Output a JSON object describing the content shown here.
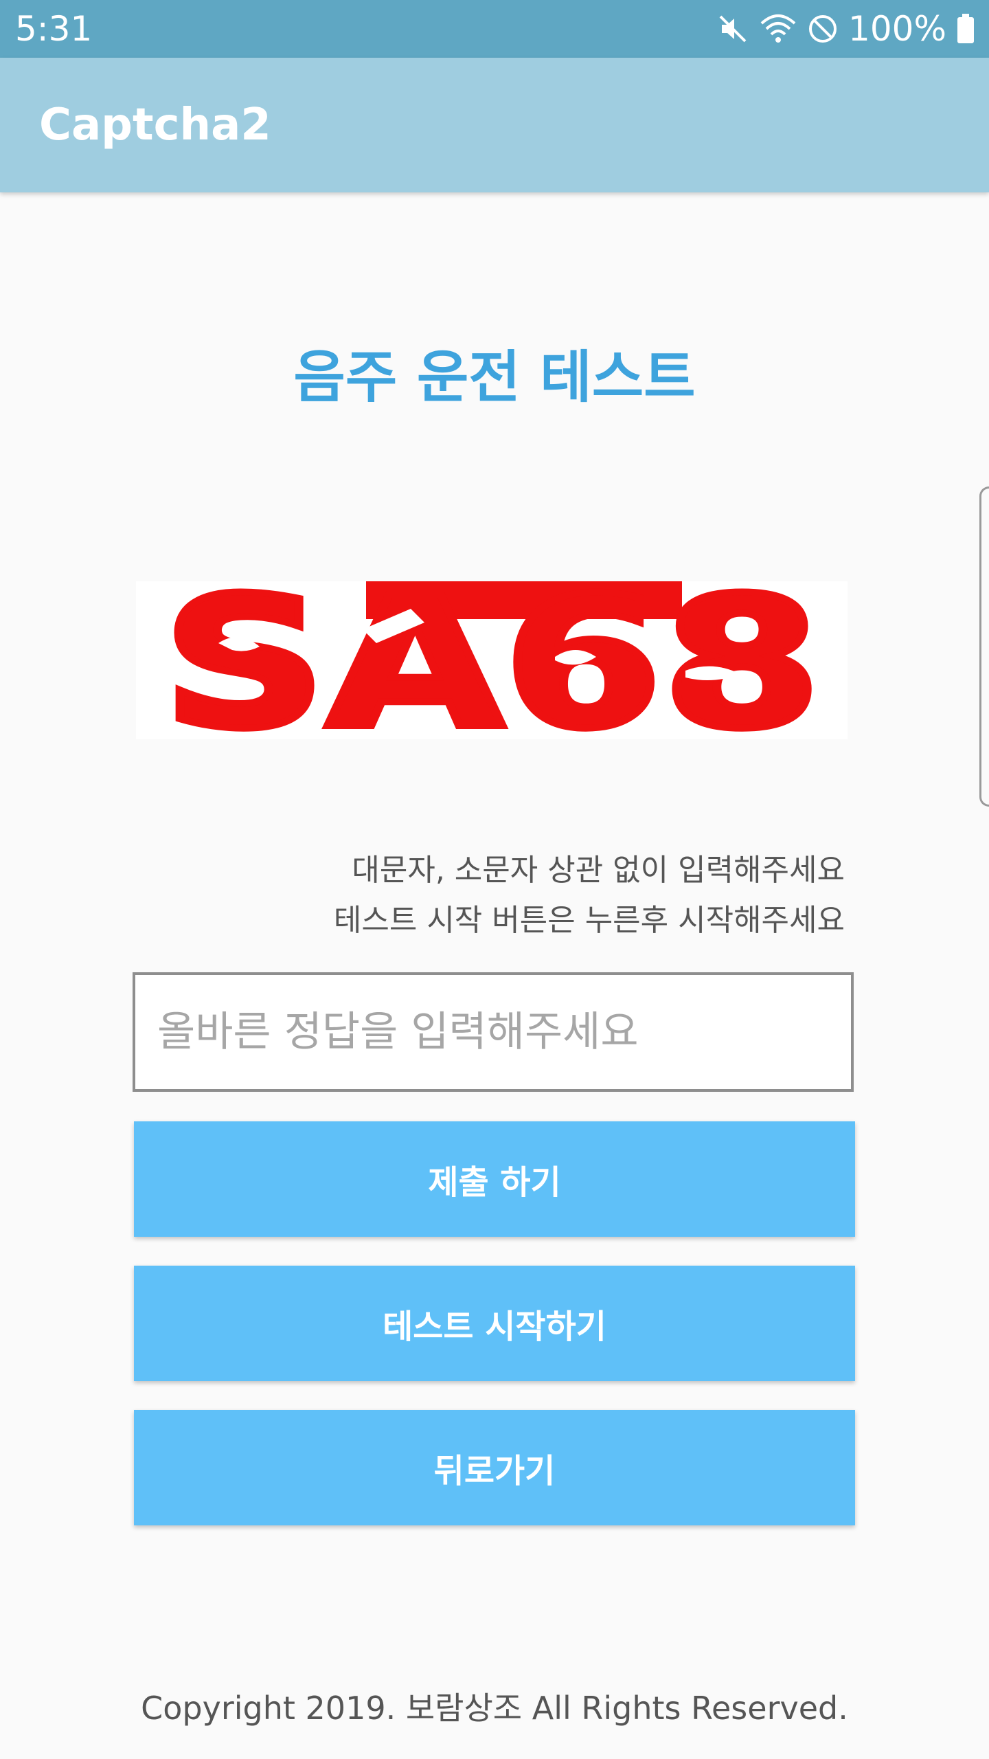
{
  "status_bar": {
    "time": "5:31",
    "battery": "100%",
    "icons": [
      "mute-icon",
      "wifi-icon",
      "no-sign-icon",
      "battery-icon"
    ]
  },
  "app_bar": {
    "title": "Captcha2"
  },
  "main": {
    "heading": "음주 운전 테스트",
    "captcha_text": "SA68",
    "hint_lines": [
      "대문자, 소문자 상관 없이 입력해주세요",
      "테스트 시작 버튼은 누른후 시작해주세요"
    ],
    "answer_input": {
      "value": "",
      "placeholder": "올바른 정답을 입력해주세요"
    },
    "buttons": {
      "submit": "제출 하기",
      "start_test": "테스트 시작하기",
      "back": "뒤로가기"
    }
  },
  "footer": {
    "copyright": "Copyright 2019. 보람상조 All Rights Reserved."
  },
  "colors": {
    "status_bar": "#5fa7c3",
    "app_bar": "#9fcde0",
    "heading": "#3ea3dd",
    "button": "#5fc0f8",
    "captcha_red": "#ee1111"
  }
}
